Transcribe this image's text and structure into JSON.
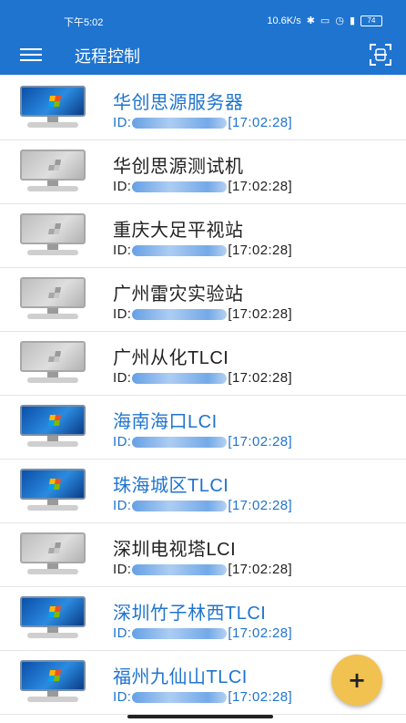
{
  "status_bar": {
    "time": "下午5:02",
    "network_speed": "10.6K/s",
    "battery": "74"
  },
  "toolbar": {
    "title": "远程控制",
    "menu_icon": "hamburger-menu-icon",
    "scan_icon": "scan-icon"
  },
  "devices": [
    {
      "name": "华创思源服务器",
      "id_prefix": "ID:",
      "time": "[17:02:28]",
      "online": true
    },
    {
      "name": "华创思源测试机",
      "id_prefix": "ID:",
      "time": "[17:02:28]",
      "online": false
    },
    {
      "name": "重庆大足平视站",
      "id_prefix": "ID:",
      "time": "[17:02:28]",
      "online": false
    },
    {
      "name": "广州雷灾实验站",
      "id_prefix": "ID:",
      "time": "[17:02:28]",
      "online": false
    },
    {
      "name": "广州从化TLCI",
      "id_prefix": "ID:",
      "time": "[17:02:28]",
      "online": false
    },
    {
      "name": "海南海口LCI",
      "id_prefix": "ID:",
      "time": "[17:02:28]",
      "online": true
    },
    {
      "name": "珠海城区TLCI",
      "id_prefix": "ID:",
      "time": "[17:02:28]",
      "online": true
    },
    {
      "name": "深圳电视塔LCI",
      "id_prefix": "ID:",
      "time": "[17:02:28]",
      "online": false
    },
    {
      "name": "深圳竹子林西TLCI",
      "id_prefix": "ID:",
      "time": "[17:02:28]",
      "online": true
    },
    {
      "name": "福州九仙山TLCI",
      "id_prefix": "ID:",
      "time": "[17:02:28]",
      "online": true
    }
  ],
  "fab": {
    "label": "+"
  },
  "colors": {
    "primary": "#1f74cf",
    "fab": "#f1c24f",
    "online_text": "#1f74cf",
    "offline_text": "#222222"
  }
}
